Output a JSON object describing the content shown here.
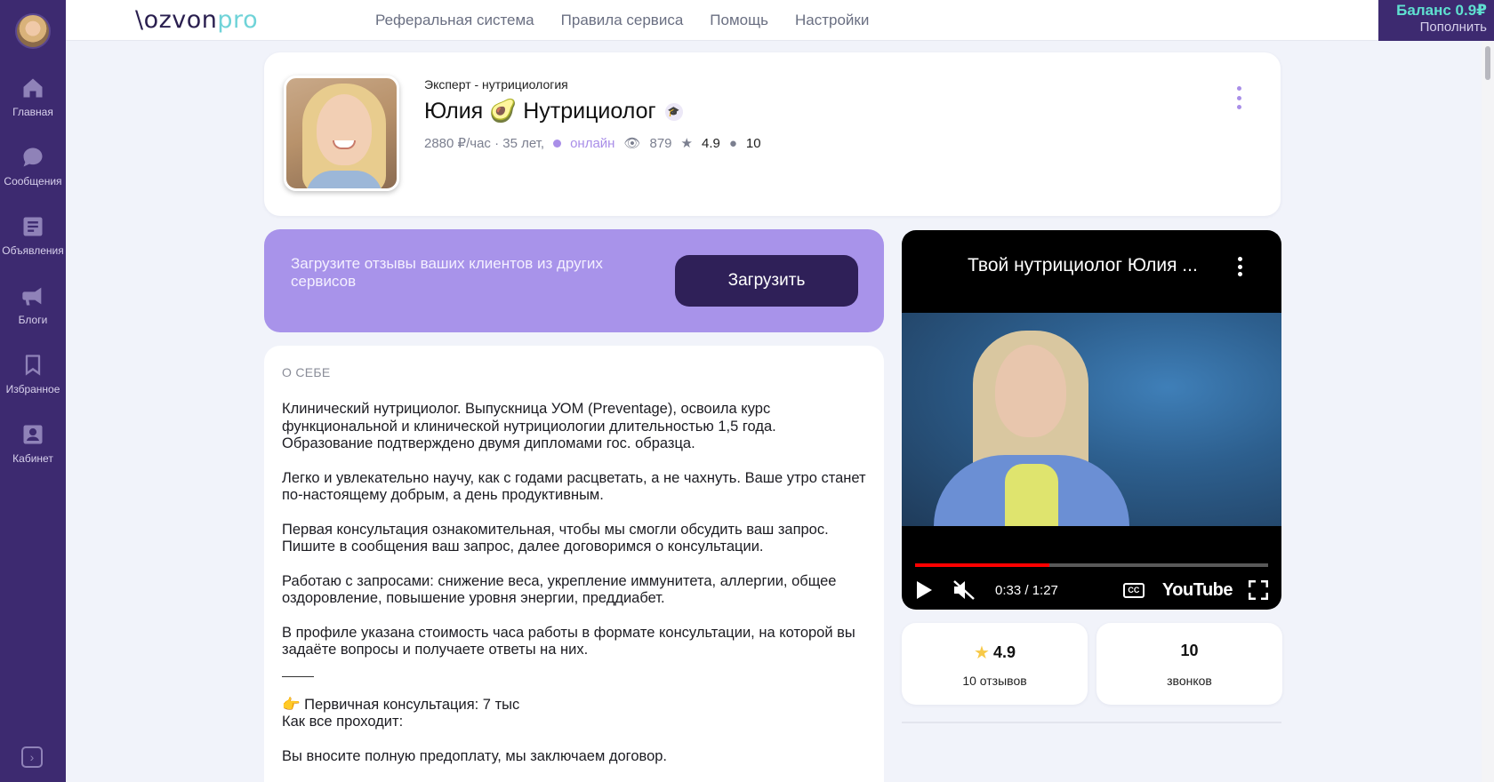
{
  "app": {
    "logo_part1": "ozvon",
    "logo_part2": "pro",
    "balance_label": "Баланс 0.9₽",
    "topup_label": "Пополнить"
  },
  "nav": [
    "Реферальная система",
    "Правила сервиса",
    "Помощь",
    "Настройки"
  ],
  "sidebar": [
    {
      "label": "Главная",
      "icon": "home-icon"
    },
    {
      "label": "Сообщения",
      "icon": "chat-icon"
    },
    {
      "label": "Объявления",
      "icon": "ads-icon"
    },
    {
      "label": "Блоги",
      "icon": "megaphone-icon"
    },
    {
      "label": "Избранное",
      "icon": "bookmark-icon"
    },
    {
      "label": "Кабинет",
      "icon": "profile-icon"
    }
  ],
  "profile": {
    "subtitle": "Эксперт - нутрициология",
    "name": "Юлия 🥑 Нутрициолог",
    "price_age": "2880 ₽/час · 35 лет,",
    "status": "онлайн",
    "views": "879",
    "rating": "4.9",
    "comments": "10"
  },
  "upload": {
    "text": "Загрузите отзывы ваших клиентов из других сервисов",
    "button": "Загрузить"
  },
  "about": {
    "title": "О СЕБЕ",
    "paragraphs": [
      "Клинический нутрициолог. Выпускница УОМ (Preventage), освоила курс функциональной и клинической нутрициологии длительностью 1,5 года. Образование подтверждено двумя дипломами гос. образца.",
      "Легко и увлекательно научу, как с годами расцветать, а не чахнуть. Ваше утро станет по-настоящему добрым, а день продуктивным.",
      "Первая консультация ознакомительная, чтобы мы смогли обсудить ваш запрос. Пишите в сообщения ваш запрос, далее договоримся о консультации.",
      "Работаю с запросами: снижение веса, укрепление иммунитета, аллергии, общее оздоровление, повышение уровня энергии, преддиабет.",
      "В профиле указана стоимость часа работы в формате консультации, на которой вы задаёте вопросы и получаете ответы на них."
    ],
    "tail_line1": "👉 Первичная консультация: 7 тыс",
    "tail_line2": "Как все проходит:",
    "tail_line3": "Вы вносите полную предоплату, мы заключаем договор."
  },
  "video": {
    "title": "Твой нутрициолог Юлия ...",
    "time": "0:33 / 1:27",
    "progress_fraction": 0.38,
    "cc_label": "CC",
    "brand": "YouTube"
  },
  "stats": {
    "rating_value": "4.9",
    "rating_label": "10 отзывов",
    "calls_value": "10",
    "calls_label": "звонков"
  }
}
